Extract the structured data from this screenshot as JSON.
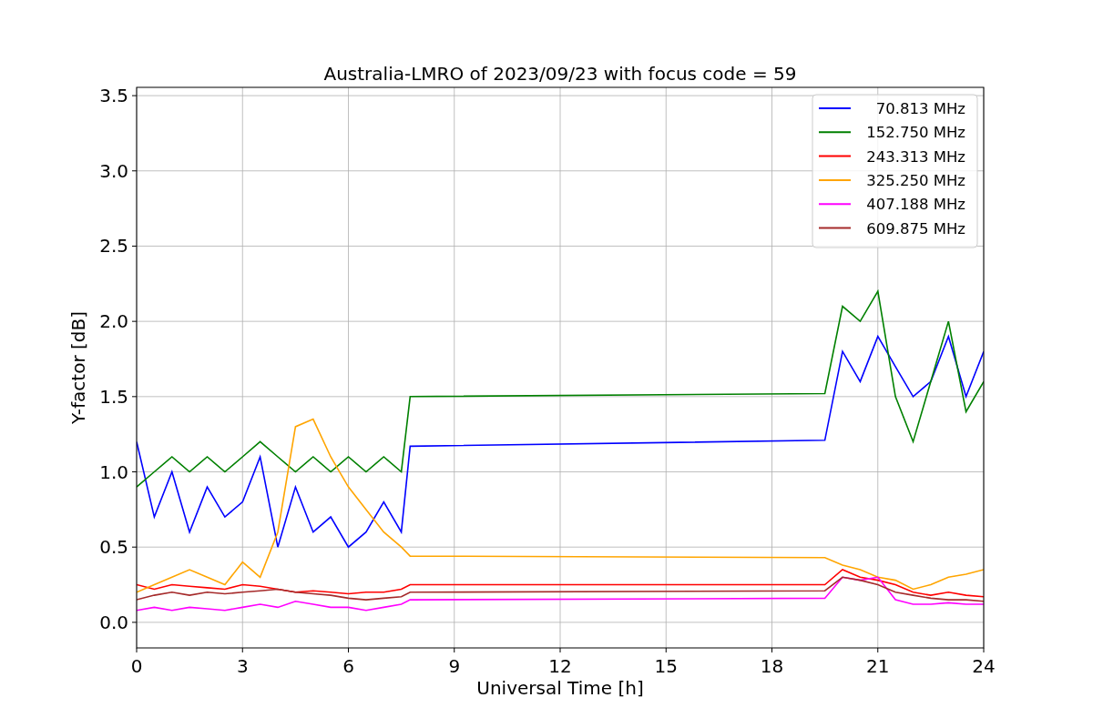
{
  "chart_data": {
    "type": "line",
    "title": "Australia-LMRO of 2023/09/23 with focus code = 59",
    "xlabel": "Universal Time [h]",
    "ylabel": "Y-factor [dB]",
    "x": [
      0,
      0.5,
      1,
      1.5,
      2,
      2.5,
      3,
      3.5,
      4,
      4.5,
      5,
      5.5,
      6,
      6.5,
      7,
      7.5,
      7.75,
      19.5,
      20,
      20.5,
      21,
      21.5,
      22,
      22.5,
      23,
      23.5,
      24
    ],
    "series": [
      {
        "name": "70.813 MHz",
        "color": "#0000ff",
        "values": [
          1.2,
          0.7,
          1.0,
          0.6,
          0.9,
          0.7,
          0.8,
          1.1,
          0.5,
          0.9,
          0.6,
          0.7,
          0.5,
          0.6,
          0.8,
          0.6,
          1.17,
          1.21,
          1.8,
          1.6,
          1.9,
          1.7,
          1.5,
          1.6,
          1.9,
          1.5,
          1.8
        ]
      },
      {
        "name": "152.750 MHz",
        "color": "#008000",
        "values": [
          0.9,
          1.0,
          1.1,
          1.0,
          1.1,
          1.0,
          1.1,
          1.2,
          1.1,
          1.0,
          1.1,
          1.0,
          1.1,
          1.0,
          1.1,
          1.0,
          1.5,
          1.52,
          2.1,
          2.0,
          2.2,
          1.5,
          1.2,
          1.6,
          2.0,
          1.4,
          1.6
        ]
      },
      {
        "name": "243.313 MHz",
        "color": "#ff0000",
        "values": [
          0.25,
          0.22,
          0.25,
          0.24,
          0.23,
          0.22,
          0.25,
          0.24,
          0.22,
          0.2,
          0.21,
          0.2,
          0.19,
          0.2,
          0.2,
          0.22,
          0.25,
          0.25,
          0.35,
          0.3,
          0.28,
          0.25,
          0.2,
          0.18,
          0.2,
          0.18,
          0.17
        ]
      },
      {
        "name": "325.250 MHz",
        "color": "#ffa500",
        "values": [
          0.2,
          0.25,
          0.3,
          0.35,
          0.3,
          0.25,
          0.4,
          0.3,
          0.6,
          1.3,
          1.35,
          1.1,
          0.9,
          0.75,
          0.6,
          0.5,
          0.44,
          0.43,
          0.38,
          0.35,
          0.3,
          0.28,
          0.22,
          0.25,
          0.3,
          0.32,
          0.35
        ]
      },
      {
        "name": "407.188 MHz",
        "color": "#ff00ff",
        "values": [
          0.08,
          0.1,
          0.08,
          0.1,
          0.09,
          0.08,
          0.1,
          0.12,
          0.1,
          0.14,
          0.12,
          0.1,
          0.1,
          0.08,
          0.1,
          0.12,
          0.15,
          0.16,
          0.3,
          0.28,
          0.3,
          0.15,
          0.12,
          0.12,
          0.13,
          0.12,
          0.12
        ]
      },
      {
        "name": "609.875 MHz",
        "color": "#a52a2a",
        "values": [
          0.15,
          0.18,
          0.2,
          0.18,
          0.2,
          0.19,
          0.2,
          0.21,
          0.22,
          0.2,
          0.19,
          0.18,
          0.16,
          0.15,
          0.16,
          0.17,
          0.2,
          0.21,
          0.3,
          0.28,
          0.25,
          0.2,
          0.18,
          0.16,
          0.15,
          0.15,
          0.14
        ]
      }
    ],
    "grid": true,
    "legend": true,
    "xlim": [
      0,
      24
    ],
    "ylim": [
      -0.17,
      3.555
    ],
    "xticks": [
      0,
      3,
      6,
      9,
      12,
      15,
      18,
      21,
      24
    ],
    "yticks": [
      {
        "value": 0,
        "label": "0.0"
      },
      {
        "value": 0.5,
        "label": "0.5"
      },
      {
        "value": 1,
        "label": "1.0"
      },
      {
        "value": 1.5,
        "label": "1.5"
      },
      {
        "value": 2,
        "label": "2.0"
      },
      {
        "value": 2.5,
        "label": "2.5"
      },
      {
        "value": 3,
        "label": "3.0"
      },
      {
        "value": 3.5,
        "label": "3.5"
      }
    ]
  }
}
